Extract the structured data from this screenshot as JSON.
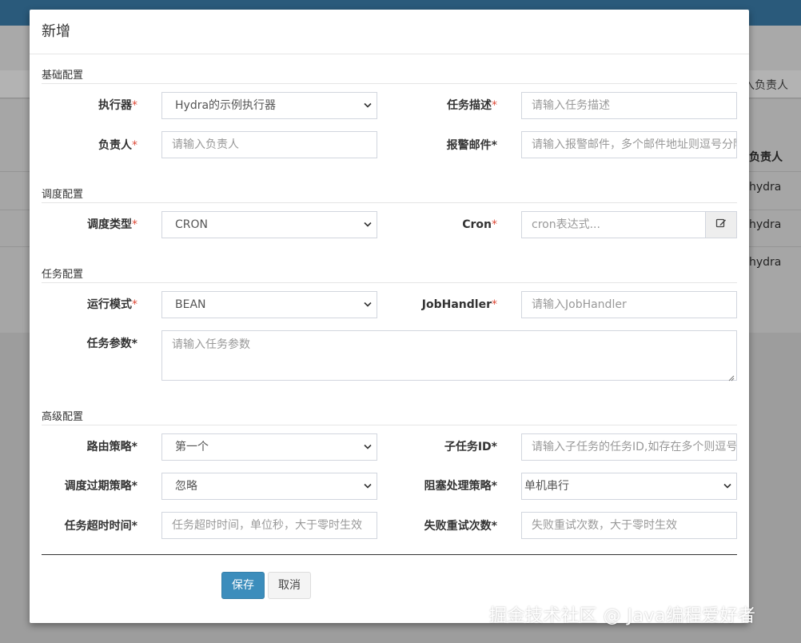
{
  "background": {
    "search_placeholder": "入负责人",
    "column_header": "负责人",
    "rows": [
      "hydra",
      "hydra",
      "hydra"
    ]
  },
  "modal": {
    "title": "新增",
    "sections": {
      "basic": "基础配置",
      "schedule": "调度配置",
      "task": "任务配置",
      "advanced": "高级配置"
    },
    "fields": {
      "executor": {
        "label": "执行器",
        "value": "Hydra的示例执行器"
      },
      "task_desc": {
        "label": "任务描述",
        "placeholder": "请输入任务描述"
      },
      "owner": {
        "label": "负责人",
        "placeholder": "请输入负责人"
      },
      "alarm_email": {
        "label": "报警邮件",
        "placeholder": "请输入报警邮件，多个邮件地址则逗号分隔"
      },
      "schedule_type": {
        "label": "调度类型",
        "value": "CRON"
      },
      "cron": {
        "label": "Cron",
        "placeholder": "cron表达式..."
      },
      "run_mode": {
        "label": "运行模式",
        "value": "BEAN"
      },
      "job_handler": {
        "label": "JobHandler",
        "placeholder": "请输入JobHandler"
      },
      "task_params": {
        "label": "任务参数",
        "placeholder": "请输入任务参数"
      },
      "route_strategy": {
        "label": "路由策略",
        "value": "第一个"
      },
      "child_task_id": {
        "label": "子任务ID",
        "placeholder": "请输入子任务的任务ID,如存在多个则逗号分隔"
      },
      "misfire_strategy": {
        "label": "调度过期策略",
        "value": "忽略"
      },
      "block_strategy": {
        "label": "阻塞处理策略",
        "value": "单机串行"
      },
      "timeout": {
        "label": "任务超时时间",
        "placeholder": "任务超时时间，单位秒，大于零时生效"
      },
      "retry_count": {
        "label": "失败重试次数",
        "placeholder": "失败重试次数，大于零时生效"
      }
    },
    "required_mark": "*",
    "buttons": {
      "save": "保存",
      "cancel": "取消"
    }
  },
  "watermark": "掘金技术社区 @ Java编程爱好者",
  "colors": {
    "primary": "#3c8dbc",
    "required": "#dd4b39",
    "topbar": "#2a5a7b"
  },
  "icons": {
    "cron_addon": "edit-icon",
    "select": "chevron-down-icon"
  }
}
